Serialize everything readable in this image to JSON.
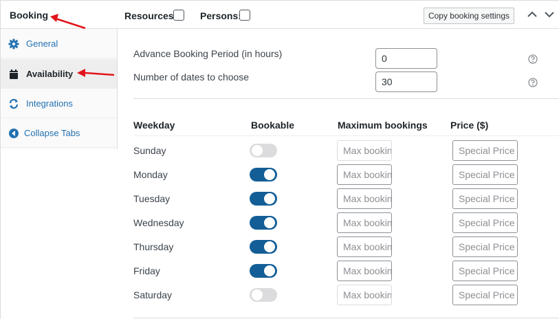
{
  "header": {
    "title": "Booking",
    "resources_label": "Resources:",
    "persons_label": "Persons:",
    "copy_button": "Copy booking settings",
    "collapse_up_icon": "chevron-up-icon",
    "collapse_down_icon": "chevron-down-icon"
  },
  "sidebar": {
    "tabs": [
      {
        "label": "General",
        "icon": "gear-icon",
        "active": false
      },
      {
        "label": "Availability",
        "icon": "calendar-icon",
        "active": true
      },
      {
        "label": "Integrations",
        "icon": "sync-icon",
        "active": false
      },
      {
        "label": "Collapse Tabs",
        "icon": "collapse-left-icon",
        "active": false
      }
    ]
  },
  "colors": {
    "accent": "#135e96",
    "link": "#2271b1",
    "annotation_arrow": "#e2141b"
  },
  "settings": {
    "advance_period_label": "Advance Booking Period (in hours)",
    "advance_period_value": "0",
    "dates_label": "Number of dates to choose",
    "dates_value": "30"
  },
  "table": {
    "headers": {
      "weekday": "Weekday",
      "bookable": "Bookable",
      "max_bookings": "Maximum bookings",
      "price": "Price ($)"
    },
    "max_placeholder": "Max bookings",
    "price_placeholder": "Special Price",
    "rows": [
      {
        "day": "Sunday",
        "bookable": false
      },
      {
        "day": "Monday",
        "bookable": true
      },
      {
        "day": "Tuesday",
        "bookable": true
      },
      {
        "day": "Wednesday",
        "bookable": true
      },
      {
        "day": "Thursday",
        "bookable": true
      },
      {
        "day": "Friday",
        "bookable": true
      },
      {
        "day": "Saturday",
        "bookable": false
      }
    ]
  }
}
